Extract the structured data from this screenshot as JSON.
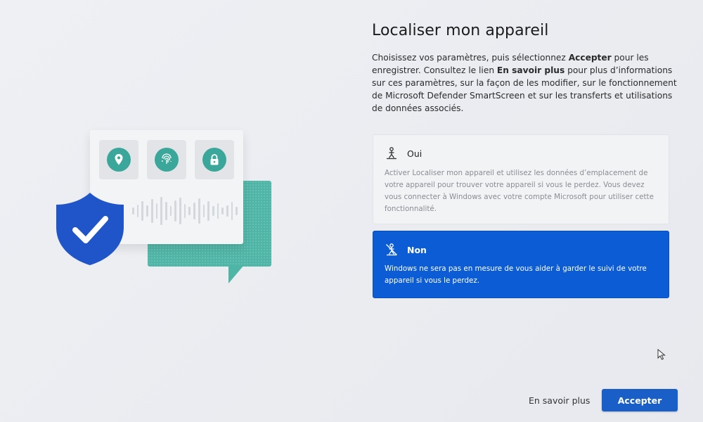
{
  "page": {
    "title": "Localiser mon appareil",
    "description": {
      "part1": "Choisissez vos paramètres, puis sélectionnez ",
      "accept_word": "Accepter",
      "part2": " pour les enregistrer. Consultez le lien ",
      "more_word": "En savoir plus",
      "part3": " pour plus d’informations sur ces paramètres, sur la façon de les modifier, sur le fonctionnement de Microsoft Defender SmartScreen et sur les transferts et utilisations de données associés."
    }
  },
  "options": {
    "yes": {
      "icon": "person-location-icon",
      "label": "Oui",
      "text": "Activer Localiser mon appareil et utilisez les données d’emplacement de votre appareil pour trouver votre appareil si vous le perdez. Vous devez vous connecter à Windows avec votre compte Microsoft pour utiliser cette fonctionnalité."
    },
    "no": {
      "icon": "person-location-off-icon",
      "label": "Non",
      "text": "Windows ne sera pas en mesure de vous aider à garder le suivi de votre appareil si vous le perdez.",
      "selected": true
    }
  },
  "footer": {
    "more_label": "En savoir plus",
    "accept_label": "Accepter"
  },
  "colors": {
    "accent": "#0b5cd5",
    "teal": "#4fb5a6",
    "shield": "#1f55c9"
  }
}
